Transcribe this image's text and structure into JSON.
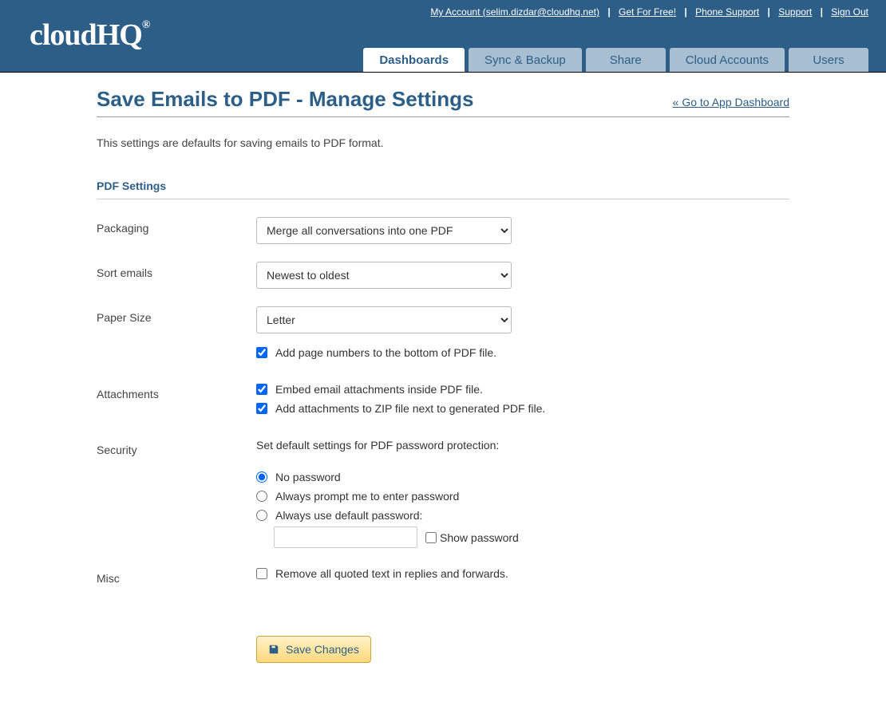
{
  "brand": "cloudHQ",
  "top_links": {
    "account": "My Account (selim.dizdar@cloudhq.net)",
    "get_free": "Get For Free!",
    "phone": "Phone Support",
    "support": "Support",
    "signout": "Sign Out"
  },
  "nav": {
    "dashboards": "Dashboards",
    "sync": "Sync & Backup",
    "share": "Share",
    "cloud": "Cloud Accounts",
    "users": "Users"
  },
  "page": {
    "title": "Save Emails to PDF - Manage Settings",
    "back_link": "« Go to App Dashboard",
    "subtitle": "This settings are defaults for saving emails to PDF format."
  },
  "section_title": "PDF Settings",
  "labels": {
    "packaging": "Packaging",
    "sort": "Sort emails",
    "paper": "Paper Size",
    "attachments": "Attachments",
    "security": "Security",
    "misc": "Misc"
  },
  "values": {
    "packaging": "Merge all conversations into one PDF",
    "sort": "Newest to oldest",
    "paper": "Letter"
  },
  "checks": {
    "page_numbers": "Add page numbers to the bottom of PDF file.",
    "embed_attachments": "Embed email attachments inside PDF file.",
    "zip_attachments": "Add attachments to ZIP file next to generated PDF file.",
    "remove_quoted": "Remove all quoted text in replies and forwards."
  },
  "security": {
    "intro": "Set default settings for PDF password protection:",
    "no_password": "No password",
    "prompt": "Always prompt me to enter password",
    "default_pw": "Always use default password:",
    "show_pw": "Show password"
  },
  "save_button": "Save Changes"
}
